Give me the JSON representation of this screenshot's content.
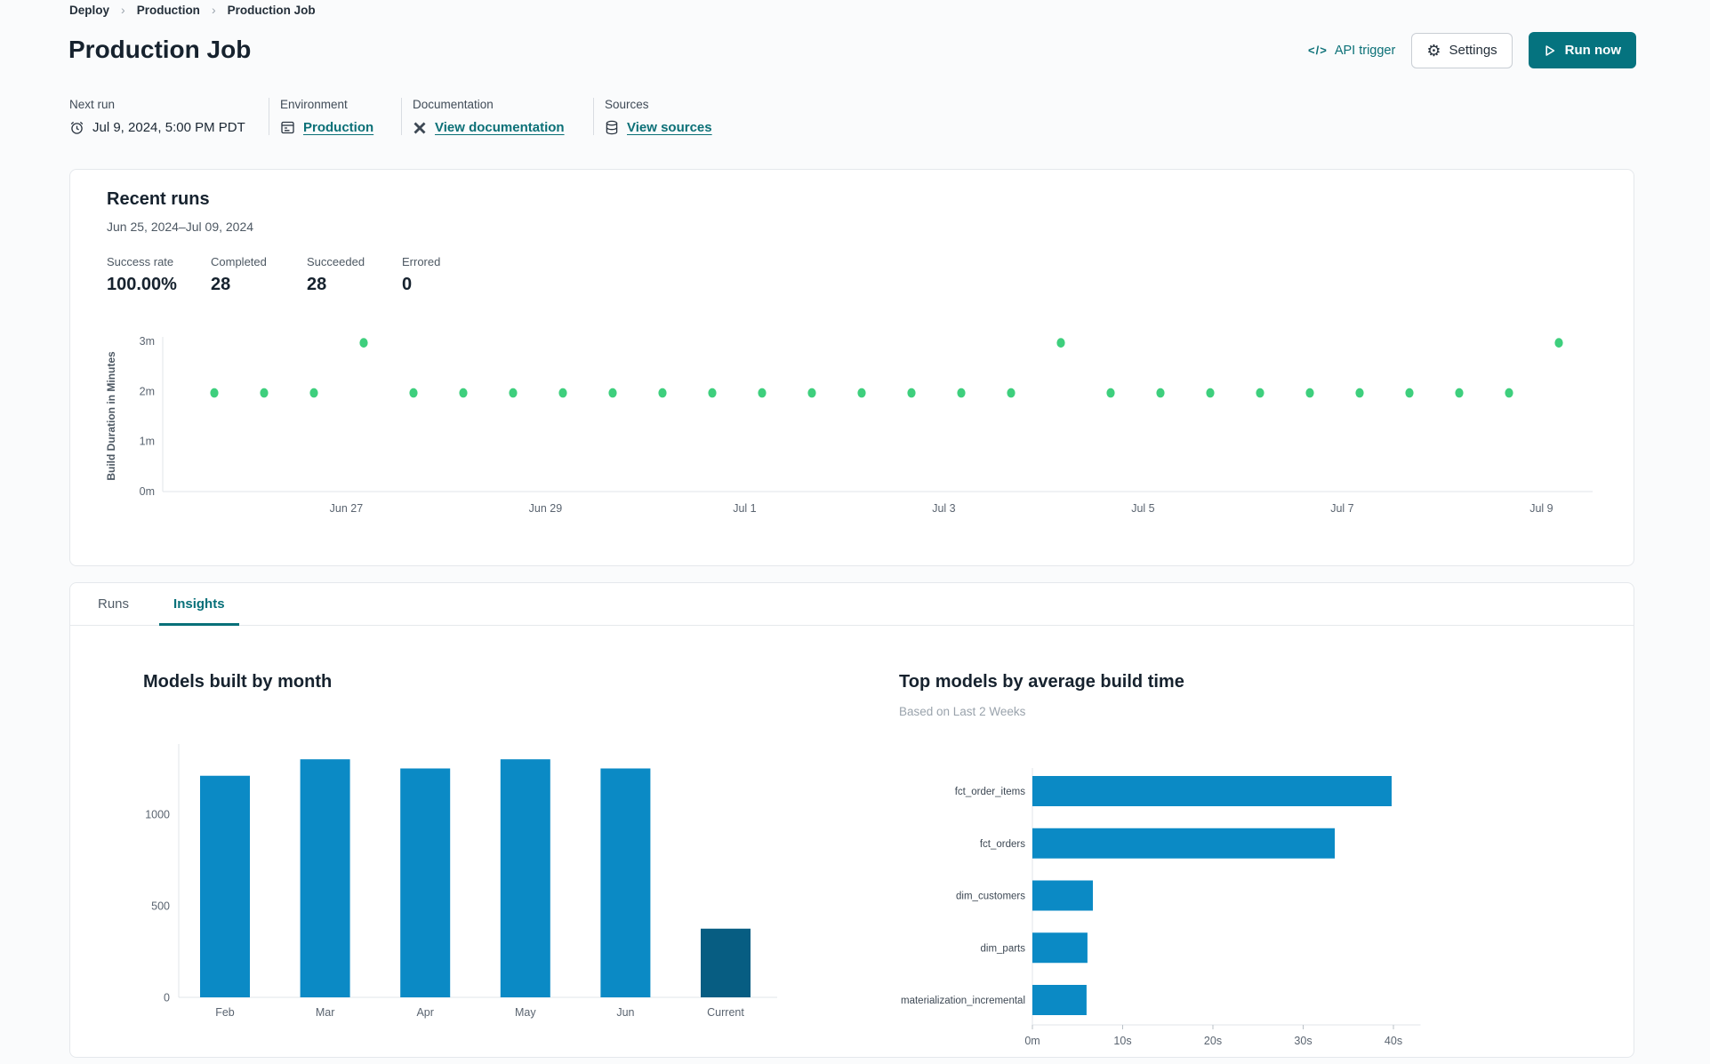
{
  "breadcrumb": {
    "separator": "›",
    "items": [
      {
        "label": "Deploy"
      },
      {
        "label": "Production"
      },
      {
        "label": "Production Job"
      }
    ]
  },
  "header": {
    "title": "Production Job",
    "api_trigger_icon": "</>",
    "api_trigger_label": "API trigger",
    "settings_label": "Settings",
    "run_now_label": "Run now"
  },
  "meta": {
    "next_run": {
      "label": "Next run",
      "value": "Jul 9, 2024, 5:00 PM PDT"
    },
    "environment": {
      "label": "Environment",
      "value": "Production"
    },
    "documentation": {
      "label": "Documentation",
      "value": "View documentation"
    },
    "sources": {
      "label": "Sources",
      "value": "View sources"
    }
  },
  "recent_runs": {
    "title": "Recent runs",
    "date_range": "Jun 25, 2024–Jul 09, 2024",
    "stats": [
      {
        "label": "Success rate",
        "value": "100.00%"
      },
      {
        "label": "Completed",
        "value": "28"
      },
      {
        "label": "Succeeded",
        "value": "28"
      },
      {
        "label": "Errored",
        "value": "0"
      }
    ]
  },
  "tabs": [
    {
      "label": "Runs",
      "active": false
    },
    {
      "label": "Insights",
      "active": true
    }
  ],
  "colors": {
    "accent_teal": "#05737f",
    "link_teal": "#0b7077",
    "dot_green": "#3ecf7d",
    "bar_blue": "#0b8ac5",
    "bar_dark_blue": "#075d82",
    "axis_line": "#e1e5e9",
    "axis_text": "#5a6470"
  },
  "chart_data": [
    {
      "id": "build-duration-scatter",
      "type": "scatter",
      "title": "",
      "ylabel": "Build Duration in Minutes",
      "ylim": [
        0,
        3
      ],
      "grid": false,
      "legend": "none",
      "point_color": "#3ecf7d",
      "yticks": [
        {
          "label": "0m",
          "value": 0
        },
        {
          "label": "1m",
          "value": 1
        },
        {
          "label": "2m",
          "value": 2
        },
        {
          "label": "3m",
          "value": 3
        }
      ],
      "xticks": [
        {
          "label": "Jun 27",
          "index": 2.65
        },
        {
          "label": "Jun 29",
          "index": 6.65
        },
        {
          "label": "Jul 1",
          "index": 10.65
        },
        {
          "label": "Jul 3",
          "index": 14.65
        },
        {
          "label": "Jul 5",
          "index": 18.65
        },
        {
          "label": "Jul 7",
          "index": 22.65
        },
        {
          "label": "Jul 9",
          "index": 26.65
        }
      ],
      "points": [
        1.97,
        1.97,
        1.97,
        2.97,
        1.97,
        1.97,
        1.97,
        1.97,
        1.97,
        1.97,
        1.97,
        1.97,
        1.97,
        1.97,
        1.97,
        1.97,
        1.97,
        2.97,
        1.97,
        1.97,
        1.97,
        1.97,
        1.97,
        1.97,
        1.97,
        1.97,
        1.97,
        2.97
      ]
    },
    {
      "id": "models-built-by-month",
      "type": "bar",
      "title": "Models built by month",
      "categories": [
        "Feb",
        "Mar",
        "Apr",
        "May",
        "Jun",
        "Current"
      ],
      "values": [
        1210,
        1300,
        1250,
        1300,
        1250,
        375
      ],
      "bar_colors": [
        "#0b8ac5",
        "#0b8ac5",
        "#0b8ac5",
        "#0b8ac5",
        "#0b8ac5",
        "#075d82"
      ],
      "yticks": [
        0,
        500,
        1000
      ],
      "ylim": [
        0,
        1430
      ],
      "xlabel": "",
      "ylabel": "",
      "grid": false,
      "legend": "none"
    },
    {
      "id": "top-models-by-average-build-time",
      "type": "hbar",
      "title": "Top models by average build time",
      "subtitle": "Based on Last 2 Weeks",
      "categories": [
        "fct_order_items",
        "fct_orders",
        "dim_customers",
        "dim_parts",
        "materialization_incremental"
      ],
      "values_seconds": [
        39.8,
        33.5,
        6.7,
        6.1,
        6.0
      ],
      "bar_color": "#0b8ac5",
      "xlim": [
        0,
        43
      ],
      "grid": false,
      "legend": "none",
      "xticks": [
        {
          "label": "0m",
          "value": 0
        },
        {
          "label": "10s",
          "value": 10
        },
        {
          "label": "20s",
          "value": 20
        },
        {
          "label": "30s",
          "value": 30
        },
        {
          "label": "40s",
          "value": 40
        }
      ]
    }
  ]
}
